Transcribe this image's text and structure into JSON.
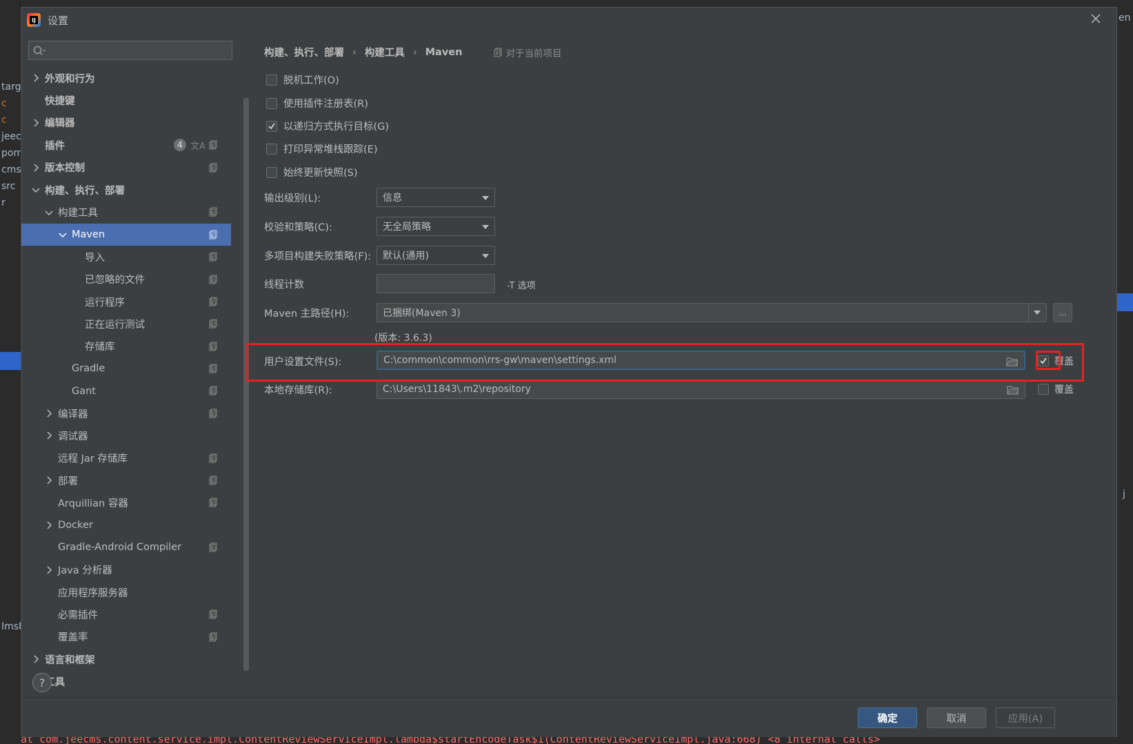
{
  "dialog": {
    "title": "设置",
    "help_label": "?"
  },
  "ide_background": {
    "left_fragments": [
      "targ",
      "c",
      "c",
      "jeec",
      "pom",
      "cms-",
      "src",
      "r",
      "ImsF"
    ],
    "right_fragments": [
      "en",
      "j"
    ],
    "console_text": "at com.jeecms.content.service.impl.ContentReviewServiceImpl.lambda$startEncodeTask$1(ContentReviewServiceImpl.java:668) <8 internal calls>"
  },
  "sidebar": {
    "search": {
      "value": "",
      "placeholder": ""
    },
    "items": [
      {
        "label": "外观和行为",
        "level": 0,
        "arrow": "right",
        "bold": true,
        "proj": false
      },
      {
        "label": "快捷键",
        "level": 0,
        "arrow": "none",
        "bold": true,
        "proj": false
      },
      {
        "label": "编辑器",
        "level": 0,
        "arrow": "right",
        "bold": true,
        "proj": false
      },
      {
        "label": "插件",
        "level": 0,
        "arrow": "none",
        "bold": true,
        "proj": true,
        "badge": "4",
        "translate": "文A"
      },
      {
        "label": "版本控制",
        "level": 0,
        "arrow": "right",
        "bold": true,
        "proj": true
      },
      {
        "label": "构建、执行、部署",
        "level": 0,
        "arrow": "down",
        "bold": true,
        "proj": false
      },
      {
        "label": "构建工具",
        "level": 1,
        "arrow": "down",
        "bold": false,
        "proj": true
      },
      {
        "label": "Maven",
        "level": 2,
        "arrow": "down",
        "bold": false,
        "proj": true,
        "selected": true
      },
      {
        "label": "导入",
        "level": 3,
        "arrow": "none",
        "bold": false,
        "proj": true
      },
      {
        "label": "已忽略的文件",
        "level": 3,
        "arrow": "none",
        "bold": false,
        "proj": true
      },
      {
        "label": "运行程序",
        "level": 3,
        "arrow": "none",
        "bold": false,
        "proj": true
      },
      {
        "label": "正在运行测试",
        "level": 3,
        "arrow": "none",
        "bold": false,
        "proj": true
      },
      {
        "label": "存储库",
        "level": 3,
        "arrow": "none",
        "bold": false,
        "proj": true
      },
      {
        "label": "Gradle",
        "level": 2,
        "arrow": "none",
        "bold": false,
        "proj": true
      },
      {
        "label": "Gant",
        "level": 2,
        "arrow": "none",
        "bold": false,
        "proj": true
      },
      {
        "label": "编译器",
        "level": 1,
        "arrow": "right",
        "bold": false,
        "proj": true
      },
      {
        "label": "调试器",
        "level": 1,
        "arrow": "right",
        "bold": false,
        "proj": false
      },
      {
        "label": "远程 Jar 存储库",
        "level": 1,
        "arrow": "none",
        "bold": false,
        "proj": true
      },
      {
        "label": "部署",
        "level": 1,
        "arrow": "right",
        "bold": false,
        "proj": true
      },
      {
        "label": "Arquillian 容器",
        "level": 1,
        "arrow": "none",
        "bold": false,
        "proj": true
      },
      {
        "label": "Docker",
        "level": 1,
        "arrow": "right",
        "bold": false,
        "proj": false
      },
      {
        "label": "Gradle-Android Compiler",
        "level": 1,
        "arrow": "none",
        "bold": false,
        "proj": true
      },
      {
        "label": "Java 分析器",
        "level": 1,
        "arrow": "right",
        "bold": false,
        "proj": false
      },
      {
        "label": "应用程序服务器",
        "level": 1,
        "arrow": "none",
        "bold": false,
        "proj": false
      },
      {
        "label": "必需插件",
        "level": 1,
        "arrow": "none",
        "bold": false,
        "proj": true
      },
      {
        "label": "覆盖率",
        "level": 1,
        "arrow": "none",
        "bold": false,
        "proj": true
      },
      {
        "label": "语言和框架",
        "level": 0,
        "arrow": "right",
        "bold": true,
        "proj": false
      },
      {
        "label": "工具",
        "level": 0,
        "arrow": "right",
        "bold": true,
        "proj": false
      }
    ]
  },
  "breadcrumb": {
    "parts": [
      "构建、执行、部署",
      "构建工具",
      "Maven"
    ],
    "separator": "›",
    "scope": "对于当前项目"
  },
  "maven": {
    "checkboxes": [
      {
        "label": "脱机工作(O)",
        "checked": false
      },
      {
        "label": "使用插件注册表(R)",
        "checked": false
      },
      {
        "label": "以递归方式执行目标(G)",
        "checked": true
      },
      {
        "label": "打印异常堆栈跟踪(E)",
        "checked": false
      },
      {
        "label": "始终更新快照(S)",
        "checked": false
      }
    ],
    "output_level": {
      "label": "输出级别(L):",
      "value": "信息"
    },
    "checksum_policy": {
      "label": "校验和策略(C):",
      "value": "无全局策略"
    },
    "multiproject_fail": {
      "label": "多项目构建失败策略(F):",
      "value": "默认(通用)"
    },
    "thread_count": {
      "label": "线程计数",
      "value": "",
      "hint": "-T 选项"
    },
    "home_path": {
      "label": "Maven 主路径(H):",
      "value": "已捆绑(Maven 3)",
      "browse": "...",
      "version": "(版本: 3.6.3)"
    },
    "user_settings": {
      "label": "用户设置文件(S):",
      "value": "C:\\common\\common\\rrs-gw\\maven\\settings.xml",
      "override_label": "覆盖",
      "override_checked": true
    },
    "local_repo": {
      "label": "本地存储库(R):",
      "value": "C:\\Users\\11843\\.m2\\repository",
      "override_label": "覆盖",
      "override_checked": false
    }
  },
  "footer": {
    "ok": "确定",
    "cancel": "取消",
    "apply": "应用(A)"
  },
  "colors": {
    "dialog_bg": "#3c3f41",
    "selection": "#4b6eaf",
    "primary_button": "#365880",
    "highlight_box": "#e52222"
  }
}
